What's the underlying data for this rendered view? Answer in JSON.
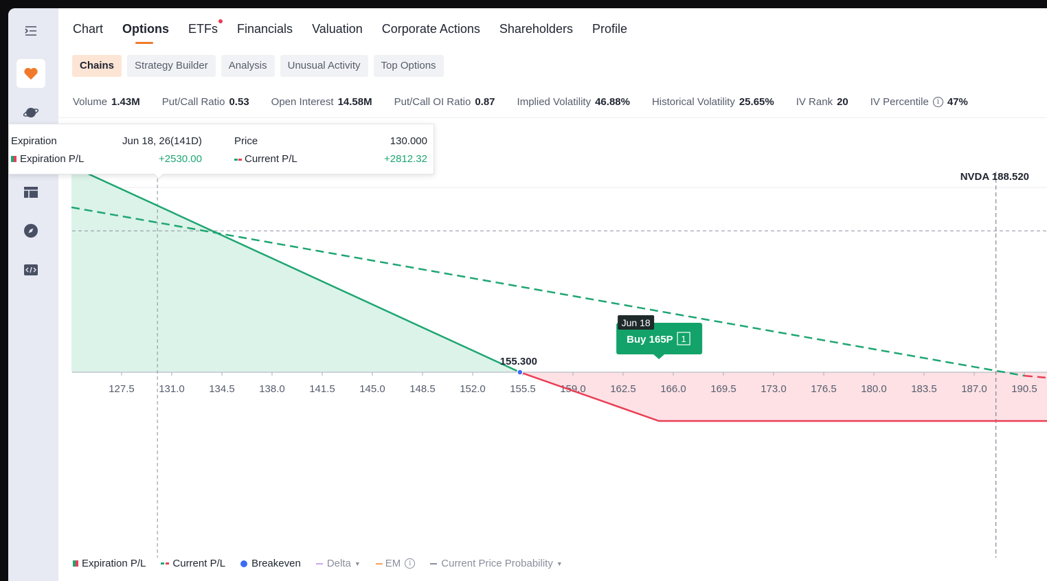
{
  "sidebar": {
    "icons": [
      "collapse-icon",
      "heart-icon",
      "planet-icon",
      "layout-icon",
      "compass-icon",
      "code-icon"
    ],
    "accent": "#f07a2a"
  },
  "topnav": {
    "tabs": [
      "Chart",
      "Options",
      "ETFs",
      "Financials",
      "Valuation",
      "Corporate Actions",
      "Shareholders",
      "Profile"
    ],
    "active": "Options"
  },
  "subtabs": {
    "items": [
      "Chains",
      "Strategy Builder",
      "Analysis",
      "Unusual Activity",
      "Top Options"
    ],
    "active": "Chains"
  },
  "stats": [
    {
      "label": "Volume",
      "value": "1.43M"
    },
    {
      "label": "Put/Call Ratio",
      "value": "0.53"
    },
    {
      "label": "Open Interest",
      "value": "14.58M"
    },
    {
      "label": "Put/Call OI Ratio",
      "value": "0.87"
    },
    {
      "label": "Implied Volatility",
      "value": "46.88%"
    },
    {
      "label": "Historical Volatility",
      "value": "25.65%"
    },
    {
      "label": "IV Rank",
      "value": "20"
    },
    {
      "label": "IV Percentile",
      "value": "47%"
    }
  ],
  "tooltip": {
    "expiration_label": "Expiration",
    "expiration_value": "Jun 18, 26(141D)",
    "price_label": "Price",
    "price_value": "130.000",
    "exp_pl_label": "Expiration P/L",
    "exp_pl_value": "+2530.00",
    "cur_pl_label": "Current P/L",
    "cur_pl_value": "+2812.32"
  },
  "chart_data": {
    "type": "line",
    "x_ticks": [
      "127.5",
      "131.0",
      "134.5",
      "138.0",
      "141.5",
      "145.0",
      "148.5",
      "152.0",
      "155.5",
      "159.0",
      "162.5",
      "166.0",
      "169.5",
      "173.0",
      "176.5",
      "180.0",
      "183.5",
      "187.0",
      "190.5"
    ],
    "breakeven": "155.300",
    "current_price_label": "NVDA 188.520",
    "strike_tag": "Jun 18",
    "position_label": "Buy 165P",
    "position_qty": "1",
    "series": [
      {
        "name": "Expiration P/L",
        "x": [
          124.0,
          155.3,
          165.0,
          193.0
        ],
        "y": [
          4100,
          0,
          -970,
          -970
        ]
      },
      {
        "name": "Current P/L",
        "x": [
          124.0,
          130.0,
          190.5,
          193.0
        ],
        "y": [
          3280,
          2812.32,
          -70,
          -110
        ]
      }
    ],
    "colors": {
      "profit": "#1ea672",
      "loss": "#ea3e55",
      "breakeven": "#3b6cf5"
    }
  },
  "legend": [
    {
      "label": "Expiration P/L"
    },
    {
      "label": "Current P/L"
    },
    {
      "label": "Breakeven"
    },
    {
      "label": "Delta"
    },
    {
      "label": "EM"
    },
    {
      "label": "Current Price Probability"
    }
  ]
}
